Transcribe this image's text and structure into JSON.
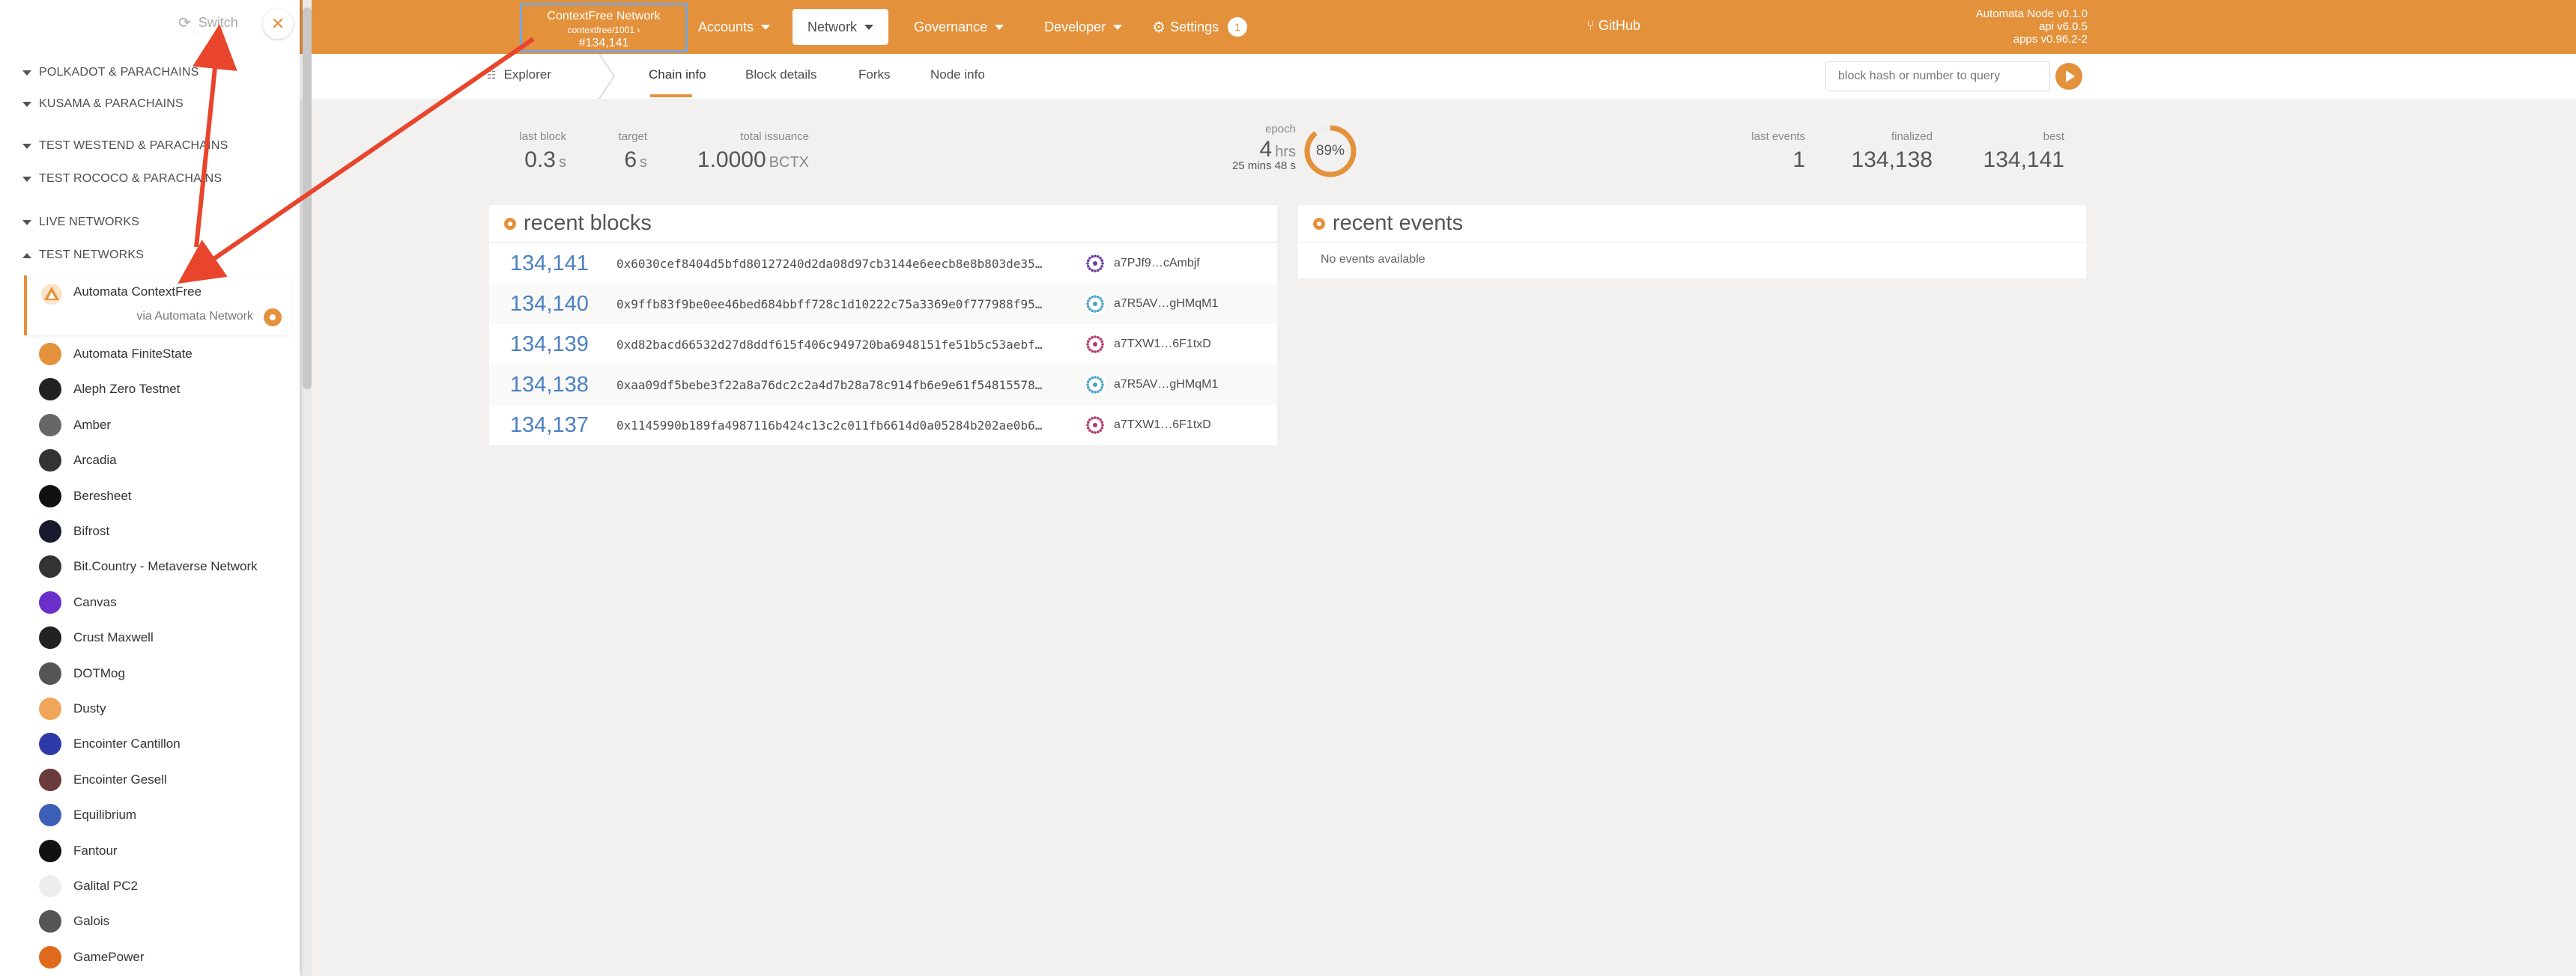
{
  "header": {
    "chain_name": "ContextFree Network",
    "chain_spec": "contextfree/1001",
    "best_block": "#134,141",
    "nav": [
      {
        "label": "Accounts"
      },
      {
        "label": "Network"
      },
      {
        "label": "Governance"
      },
      {
        "label": "Developer"
      },
      {
        "label": "Settings"
      }
    ],
    "settings_badge": "1",
    "github_label": "GitHub",
    "version_node": "Automata Node v0.1.0",
    "version_api": "api v6.0.5",
    "version_apps": "apps v0.96.2-2"
  },
  "subnav": {
    "section": "Explorer",
    "tabs": [
      "Chain info",
      "Block details",
      "Forks",
      "Node info"
    ],
    "search_placeholder": "block hash or number to query"
  },
  "summary": {
    "last_block_label": "last block",
    "last_block_value": "0.3",
    "last_block_unit": "s",
    "target_label": "target",
    "target_value": "6",
    "target_unit": "s",
    "issuance_label": "total issuance",
    "issuance_value": "1.0000",
    "issuance_unit": "BCTX",
    "epoch_label": "epoch",
    "epoch_value": "4",
    "epoch_unit": "hrs",
    "epoch_detail": "25 mins 48 s",
    "epoch_percent": "89%",
    "epoch_fraction": 0.89,
    "last_events_label": "last events",
    "last_events_value": "1",
    "finalized_label": "finalized",
    "finalized_value": "134,138",
    "best_label": "best",
    "best_value": "134,141"
  },
  "recent_blocks": {
    "title": "recent blocks",
    "rows": [
      {
        "number": "134,141",
        "hash": "0x6030cef8404d5bfd80127240d2da08d97cb3144e6eecb8e8b803de35…",
        "author": "a7PJf9…cAmbjf",
        "icon_color": "#6a3fa0"
      },
      {
        "number": "134,140",
        "hash": "0x9ffb83f9be0ee46bed684bbff728c1d10222c75a3369e0f777988f95…",
        "author": "a7R5AV…gHMqM1",
        "icon_color": "#4aa3c8"
      },
      {
        "number": "134,139",
        "hash": "0xd82bacd66532d27d8ddf615f406c949720ba6948151fe51b5c53aebf…",
        "author": "a7TXW1…6F1txD",
        "icon_color": "#b23a6a"
      },
      {
        "number": "134,138",
        "hash": "0xaa09df5bebe3f22a8a76dc2c2a4d7b28a78c914fb6e9e61f54815578…",
        "author": "a7R5AV…gHMqM1",
        "icon_color": "#4aa3c8"
      },
      {
        "number": "134,137",
        "hash": "0x1145990b189fa4987116b424c13c2c011fb6614d0a05284b202ae0b6…",
        "author": "a7TXW1…6F1txD",
        "icon_color": "#b23a6a"
      }
    ]
  },
  "recent_events": {
    "title": "recent events",
    "empty": "No events available"
  },
  "sidebar": {
    "switch_label": "Switch",
    "groups": [
      {
        "label": "POLKADOT & PARACHAINS",
        "open": false
      },
      {
        "label": "KUSAMA & PARACHAINS",
        "open": false
      },
      {
        "label": "TEST WESTEND & PARACHAINS",
        "open": false
      },
      {
        "label": "TEST ROCOCO & PARACHAINS",
        "open": false
      },
      {
        "label": "LIVE NETWORKS",
        "open": false
      },
      {
        "label": "TEST NETWORKS",
        "open": true
      }
    ],
    "selected": {
      "name": "Automata ContextFree",
      "via": "via Automata Network"
    },
    "networks": [
      {
        "name": "Automata FiniteState",
        "color": "#e4913c"
      },
      {
        "name": "Aleph Zero Testnet",
        "color": "#222222"
      },
      {
        "name": "Amber",
        "color": "#666666"
      },
      {
        "name": "Arcadia",
        "color": "#333333"
      },
      {
        "name": "Beresheet",
        "color": "#111111"
      },
      {
        "name": "Bifrost",
        "color": "#1a1a2e"
      },
      {
        "name": "Bit.Country - Metaverse Network",
        "color": "#333333"
      },
      {
        "name": "Canvas",
        "color": "#6b2fc9"
      },
      {
        "name": "Crust Maxwell",
        "color": "#222222"
      },
      {
        "name": "DOTMog",
        "color": "#555555"
      },
      {
        "name": "Dusty",
        "color": "#f0a65a"
      },
      {
        "name": "Encointer Cantillon",
        "color": "#2d3aa8"
      },
      {
        "name": "Encointer Gesell",
        "color": "#6b3a3a"
      },
      {
        "name": "Equilibrium",
        "color": "#3e5fb8"
      },
      {
        "name": "Fantour",
        "color": "#111111"
      },
      {
        "name": "Galital PC2",
        "color": "#eeeeee"
      },
      {
        "name": "Galois",
        "color": "#555555"
      },
      {
        "name": "GamePower",
        "color": "#e06a1b"
      }
    ]
  },
  "colors": {
    "accent": "#e4913c",
    "link": "#4b81c1",
    "annotation_arrow": "#e8452c",
    "highlight_box": "#76a6dd"
  }
}
